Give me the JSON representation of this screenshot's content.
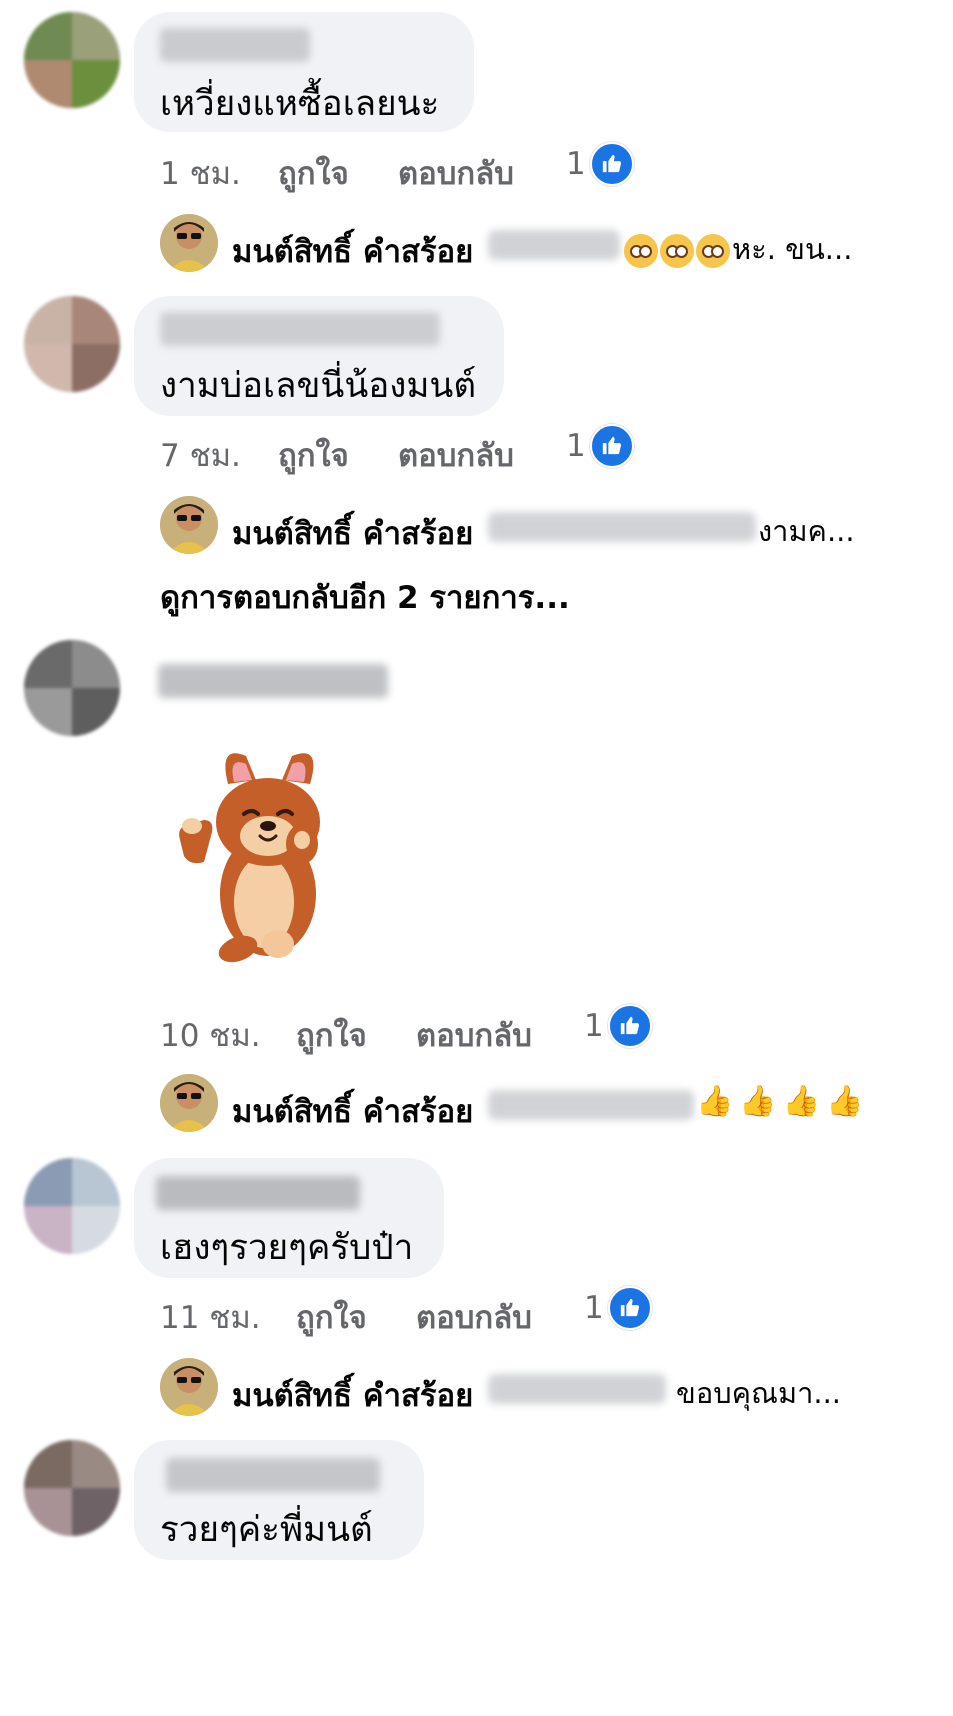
{
  "comments": [
    {
      "text": "เหวี่ยงแหซื้อเลยนะ",
      "time": "1 ชม.",
      "like_label": "ถูกใจ",
      "reply_label": "ตอบกลับ",
      "like_count": "1",
      "reply": {
        "author": "มนต์สิทธิ์ คำสร้อย",
        "tail": "หะ. ขน...",
        "tail_emoji": [
          "flushed-face-emoji",
          "flushed-face-emoji",
          "flushed-face-emoji"
        ]
      }
    },
    {
      "text": "งามบ่อเลขนี่น้องมนต์",
      "time": "7 ชม.",
      "like_label": "ถูกใจ",
      "reply_label": "ตอบกลับ",
      "like_count": "1",
      "reply": {
        "author": "มนต์สิทธิ์ คำสร้อย",
        "tail": "งามค..."
      },
      "view_more": "ดูการตอบกลับอีก 2 รายการ..."
    },
    {
      "sticker": "corgi-thinking-sticker",
      "time": "10 ชม.",
      "like_label": "ถูกใจ",
      "reply_label": "ตอบกลับ",
      "like_count": "1",
      "reply": {
        "author": "มนต์สิทธิ์ คำสร้อย",
        "tail_emoji": [
          "thumbs-up-emoji",
          "thumbs-up-emoji",
          "thumbs-up-emoji",
          "thumbs-up-emoji"
        ]
      }
    },
    {
      "text": "เฮงๆรวยๆครับป๋า",
      "time": "11 ชม.",
      "like_label": "ถูกใจ",
      "reply_label": "ตอบกลับ",
      "like_count": "1",
      "reply": {
        "author": "มนต์สิทธิ์ คำสร้อย",
        "tail": "ขอบคุณมา..."
      }
    },
    {
      "text": "รวยๆค่ะพี่มนต์"
    }
  ],
  "colors": {
    "bubble": "#f0f2f5",
    "meta_text": "#65676b",
    "like_blue": "#1b74e4"
  }
}
